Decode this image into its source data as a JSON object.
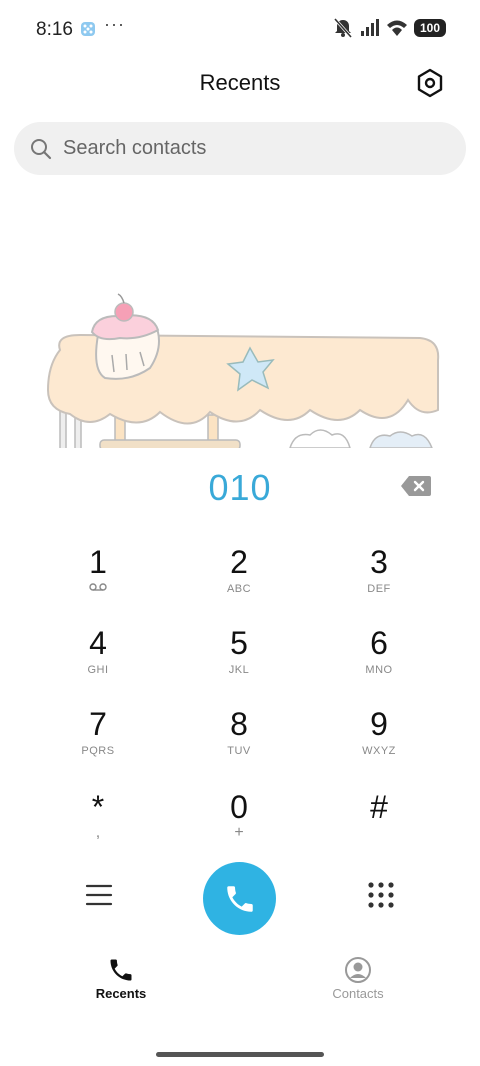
{
  "status_bar": {
    "time": "8:16",
    "dots": "···",
    "battery": "100"
  },
  "header": {
    "title": "Recents"
  },
  "search": {
    "placeholder": "Search contacts"
  },
  "dialer": {
    "entered_number": "010",
    "keys": [
      {
        "digit": "1",
        "letters": "voicemail-icon"
      },
      {
        "digit": "2",
        "letters": "ABC"
      },
      {
        "digit": "3",
        "letters": "DEF"
      },
      {
        "digit": "4",
        "letters": "GHI"
      },
      {
        "digit": "5",
        "letters": "JKL"
      },
      {
        "digit": "6",
        "letters": "MNO"
      },
      {
        "digit": "7",
        "letters": "PQRS"
      },
      {
        "digit": "8",
        "letters": "TUV"
      },
      {
        "digit": "9",
        "letters": "WXYZ"
      },
      {
        "digit": "*",
        "letters": ","
      },
      {
        "digit": "0",
        "letters": "+"
      },
      {
        "digit": "#",
        "letters": ""
      }
    ]
  },
  "bottom_nav": {
    "recents_label": "Recents",
    "contacts_label": "Contacts"
  },
  "colors": {
    "accent": "#39a9d8",
    "call_button": "#2fb3e3",
    "search_bg": "#f0f0f0"
  }
}
